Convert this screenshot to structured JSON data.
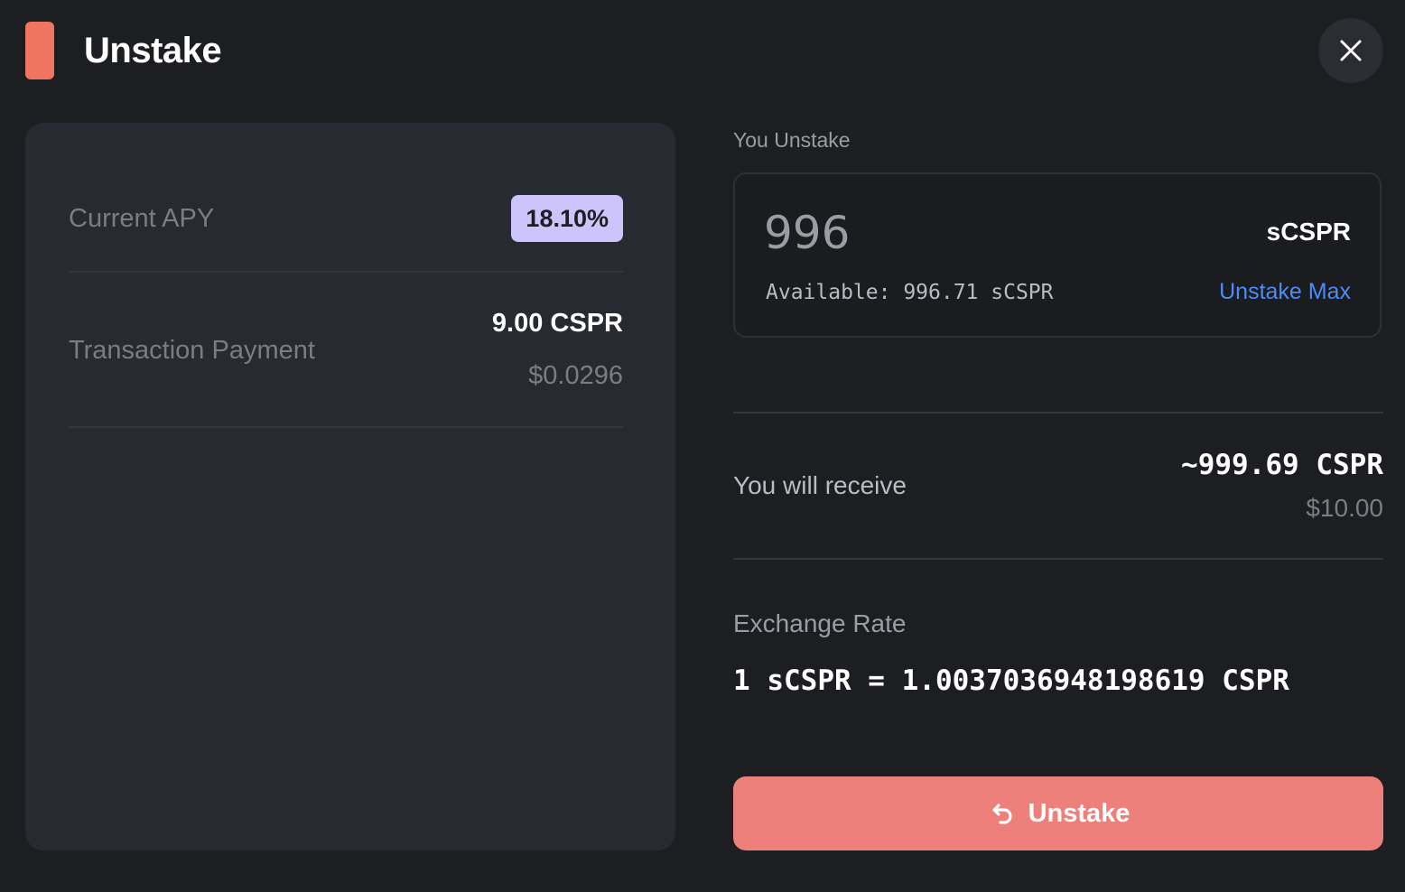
{
  "header": {
    "title": "Unstake",
    "accent_color": "#ef7561",
    "close_icon": "close-icon"
  },
  "info_card": {
    "apy": {
      "label": "Current APY",
      "value": "18.10%",
      "badge_color": "#cdc4fb"
    },
    "transaction_payment": {
      "label": "Transaction Payment",
      "amount": "9.00 CSPR",
      "usd": "$0.0296"
    }
  },
  "unstake_form": {
    "section_label": "You Unstake",
    "amount_value": "996",
    "token": "sCSPR",
    "available": "Available: 996.71 sCSPR",
    "max_link": "Unstake Max",
    "link_color": "#4d8bf5"
  },
  "receive": {
    "label": "You will receive",
    "amount": "~999.69 CSPR",
    "usd": "$10.00"
  },
  "exchange_rate": {
    "label": "Exchange Rate",
    "value": "1 sCSPR = 1.0037036948198619 CSPR"
  },
  "submit": {
    "label": "Unstake",
    "icon": "undo-arrow-icon",
    "color": "#ee807b"
  }
}
